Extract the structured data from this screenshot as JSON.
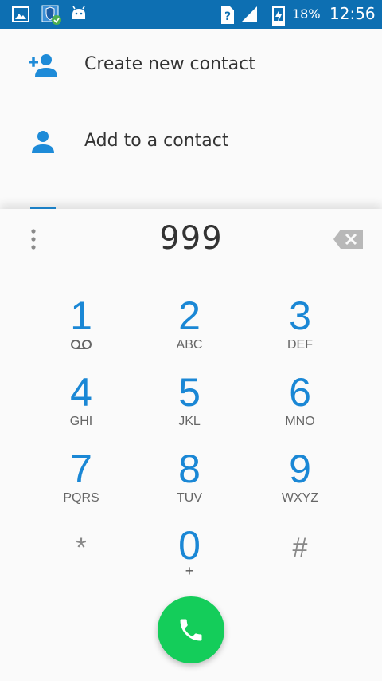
{
  "status_bar": {
    "battery_percent": "18%",
    "time": "12:56",
    "icons": [
      "gallery-icon",
      "security-shield-icon",
      "android-icon",
      "no-sim-icon",
      "signal-icon",
      "battery-charging-icon"
    ]
  },
  "contact_options": [
    {
      "label": "Create new contact",
      "icon": "person-add-icon"
    },
    {
      "label": "Add to a contact",
      "icon": "person-icon"
    }
  ],
  "dialer": {
    "digits": "999",
    "keys": [
      {
        "num": "1",
        "letters": "",
        "voicemail": true
      },
      {
        "num": "2",
        "letters": "ABC"
      },
      {
        "num": "3",
        "letters": "DEF"
      },
      {
        "num": "4",
        "letters": "GHI"
      },
      {
        "num": "5",
        "letters": "JKL"
      },
      {
        "num": "6",
        "letters": "MNO"
      },
      {
        "num": "7",
        "letters": "PQRS"
      },
      {
        "num": "8",
        "letters": "TUV"
      },
      {
        "num": "9",
        "letters": "WXYZ"
      },
      {
        "num": "*",
        "letters": ""
      },
      {
        "num": "0",
        "letters": "+"
      },
      {
        "num": "#",
        "letters": ""
      }
    ]
  },
  "colors": {
    "status_bar": "#0d6fb2",
    "accent_blue": "#1a87d5",
    "call_green": "#14cd5a",
    "background": "#fafafa"
  }
}
